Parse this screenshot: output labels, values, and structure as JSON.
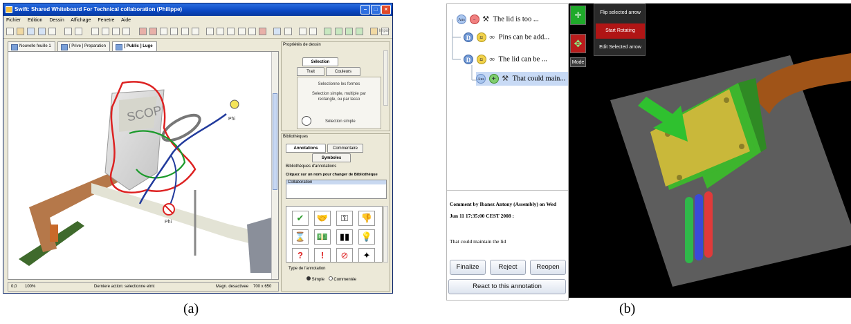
{
  "panel_a": {
    "caption": "(a)",
    "window": {
      "title": "Swift: Shared Whiteboard For Technical collaboration (Philippe)"
    },
    "menu": [
      "Fichier",
      "Edition",
      "Dessin",
      "Affichage",
      "Fenetre",
      "Aide"
    ],
    "toolbar_right_text": "Impor",
    "doc_tabs": [
      "Nouvelle feuille 1",
      "[ Prive ] Preparation",
      "[ Public ] Luge"
    ],
    "canvas": {
      "banner_text": "SCOP",
      "phi_labels": [
        "Phi",
        "Phi"
      ]
    },
    "statusbar": {
      "coords": "0,0",
      "zoom": "100%",
      "last_action": "Derniere action: selectionne elmt",
      "magnet": "Magn. desactivee",
      "size": "700 x 650"
    },
    "props": {
      "section_title": "Propriétés de dessin",
      "tab_selection": "Sélection",
      "tab_trait": "Trait",
      "tab_couleurs": "Couleurs",
      "help_title": "Selectionne les formes",
      "help_body": "Selection simple, multiple par rectangle, ou par lasso",
      "selection_mode": "Sélection simple"
    },
    "library": {
      "section_title": "Bibliothèques",
      "tab_annotations": "Annotations",
      "tab_commentaire": "Commentaire",
      "tab_symboles": "Symboles",
      "group_title": "Bibliothèques d'annotations",
      "hint": "Cliquez sur un nom pour changer de Bibliothèque",
      "list": [
        "Collaboration"
      ],
      "icons": [
        "check-icon",
        "handshake-icon",
        "key-icon",
        "thumbs-down-icon",
        "hourglass-icon",
        "money-icon",
        "progress-icon",
        "lightbulb-icon",
        "question-icon",
        "exclamation-icon",
        "forbidden-icon",
        "idea-icon"
      ]
    },
    "annotation_type": {
      "title": "Type de l'annotation",
      "options": [
        "Simple",
        "Commentée"
      ],
      "selected": "Simple"
    }
  },
  "panel_b": {
    "caption": "(b)",
    "tree": [
      {
        "badge": "Aus",
        "kind": "red",
        "text": "The lid is too ..."
      },
      {
        "badge": "D",
        "kind": "yel",
        "text": "Pins can be add..."
      },
      {
        "badge": "D",
        "kind": "yel",
        "text": "The lid can be ..."
      },
      {
        "badge": "Aus",
        "kind": "grn",
        "text": "That could main..."
      }
    ],
    "comment": {
      "header": "Comment by Ibanez Antony (Assembly) on Wed Jun 11 17:35:00 CEST 2008 :",
      "body": "That could maintain the lid"
    },
    "buttons": {
      "finalize": "Finalize",
      "reject": "Reject",
      "reopen": "Reopen",
      "react": "React to this annotation"
    },
    "viewer_menu": {
      "flip": "Flip selected arrow",
      "rotate": "Start Rotating",
      "edit": "Edit Selected arrow"
    },
    "mode_label": "Mode",
    "colors": {
      "box_body": "#3db52d",
      "box_lid": "#c9b83a",
      "pipe": "#a05418",
      "plate": "#5d5d5d"
    }
  }
}
